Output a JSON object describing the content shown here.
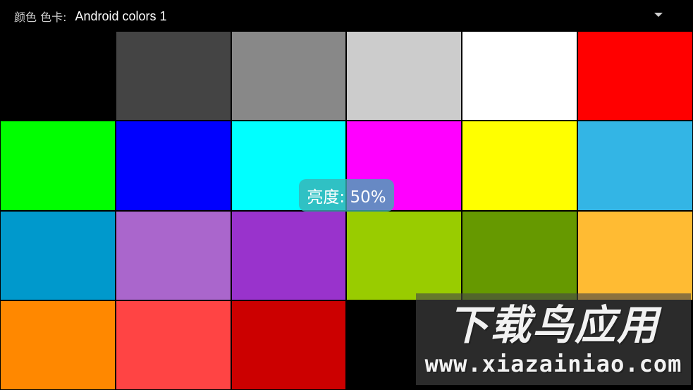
{
  "header": {
    "label": "颜色 色卡:",
    "selected": "Android colors 1"
  },
  "swatches": [
    {
      "name": "black",
      "color": "#000000"
    },
    {
      "name": "dark-gray",
      "color": "#444444"
    },
    {
      "name": "gray",
      "color": "#888888"
    },
    {
      "name": "light-gray",
      "color": "#cccccc"
    },
    {
      "name": "white",
      "color": "#ffffff"
    },
    {
      "name": "red",
      "color": "#ff0000"
    },
    {
      "name": "green",
      "color": "#00ff00"
    },
    {
      "name": "blue",
      "color": "#0000ff"
    },
    {
      "name": "cyan",
      "color": "#00ffff"
    },
    {
      "name": "magenta",
      "color": "#ff00ff"
    },
    {
      "name": "yellow",
      "color": "#ffff00"
    },
    {
      "name": "holo-blue-light",
      "color": "#33b5e5"
    },
    {
      "name": "holo-blue-dark",
      "color": "#0099cc"
    },
    {
      "name": "holo-purple-light",
      "color": "#aa66cc"
    },
    {
      "name": "holo-purple-dark",
      "color": "#9933cc"
    },
    {
      "name": "holo-green-light",
      "color": "#99cc00"
    },
    {
      "name": "holo-green-dark",
      "color": "#669900"
    },
    {
      "name": "holo-orange-light",
      "color": "#ffbb33"
    },
    {
      "name": "holo-orange-dark",
      "color": "#ff8800"
    },
    {
      "name": "holo-red-light",
      "color": "#ff4444"
    },
    {
      "name": "holo-red-dark",
      "color": "#cc0000"
    },
    {
      "name": "black-2",
      "color": "#000000"
    },
    {
      "name": "black-3",
      "color": "#000000"
    },
    {
      "name": "black-4",
      "color": "#000000"
    }
  ],
  "toast": {
    "text": "亮度: 50%"
  },
  "watermark": {
    "title": "下载鸟应用",
    "url": "www.xiazainiao.com"
  }
}
